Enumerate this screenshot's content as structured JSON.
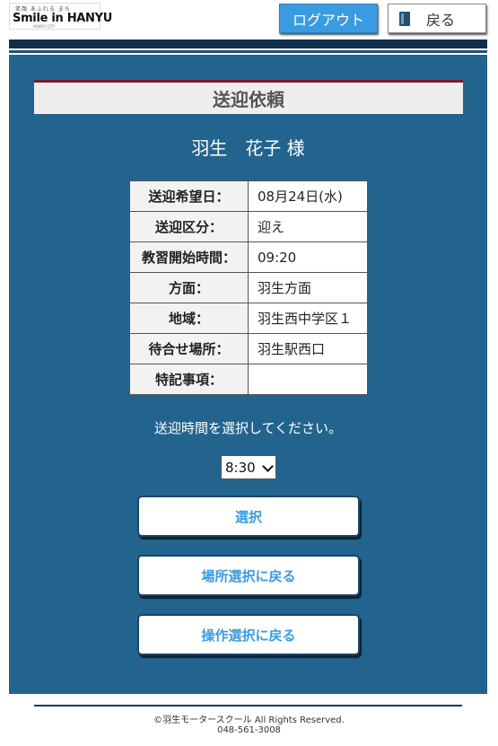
{
  "header": {
    "logo": {
      "small_text": "笑顔 あふれる まち",
      "text": "Smile in HANYU",
      "tagline": "HANYU CITY"
    },
    "logout_label": "ログアウト",
    "back_label": "戻る"
  },
  "main": {
    "title": "送迎依頼",
    "customer": "羽生　花子 様",
    "details": [
      {
        "key": "送迎希望日：",
        "value": "08月24日(水)"
      },
      {
        "key": "送迎区分：",
        "value": "迎え"
      },
      {
        "key": "教習開始時間：",
        "value": "09:20"
      },
      {
        "key": "方面：",
        "value": "羽生方面"
      },
      {
        "key": "地域：",
        "value": "羽生西中学区１"
      },
      {
        "key": "待合せ場所：",
        "value": "羽生駅西口"
      },
      {
        "key": "特記事項：",
        "value": ""
      }
    ],
    "prompt": "送迎時間を選択してください。",
    "time_select": {
      "selected": "8:30"
    },
    "buttons": {
      "select": "選択",
      "back_to_place": "場所選択に戻る",
      "back_to_operation": "操作選択に戻る"
    }
  },
  "footer": {
    "copyright": "©羽生モータースクール All Rights Reserved.",
    "phone": "048-561-3008"
  },
  "colors": {
    "panel": "#23648e",
    "accent": "#3a9be0",
    "dark_stripe": "#0f2f4c"
  }
}
